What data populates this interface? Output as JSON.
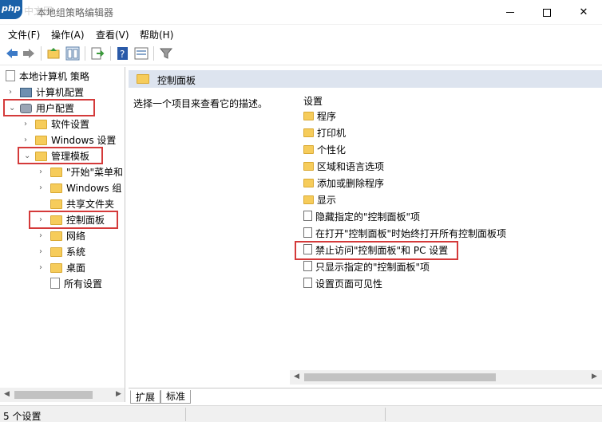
{
  "window": {
    "title": "本地组策略编辑器",
    "app_icon_text": "php",
    "watermark": "中文网",
    "minimize": "minimize",
    "maximize": "maximize",
    "close": "close"
  },
  "menu": [
    "文件(F)",
    "操作(A)",
    "查看(V)",
    "帮助(H)"
  ],
  "toolbar": {
    "icons": [
      "back-icon",
      "forward-icon",
      "up-folder-icon",
      "show-hide-tree-icon",
      "export-list-icon",
      "help-icon",
      "properties-icon",
      "filter-icon"
    ]
  },
  "tree": {
    "root": "本地计算机 策略",
    "computer_config": "计算机配置",
    "user_config": "用户配置",
    "software_settings": "软件设置",
    "windows_settings": "Windows 设置",
    "admin_templates": "管理模板",
    "start_menu": "\"开始\"菜单和",
    "windows_components": "Windows 组",
    "shared_folders": "共享文件夹",
    "control_panel": "控制面板",
    "network": "网络",
    "system": "系统",
    "desktop": "桌面",
    "all_settings": "所有设置"
  },
  "right": {
    "header": "控制面板",
    "description": "选择一个项目来查看它的描述。",
    "column_header": "设置",
    "items": [
      {
        "label": "程序",
        "type": "folder"
      },
      {
        "label": "打印机",
        "type": "folder"
      },
      {
        "label": "个性化",
        "type": "folder"
      },
      {
        "label": "区域和语言选项",
        "type": "folder"
      },
      {
        "label": "添加或删除程序",
        "type": "folder"
      },
      {
        "label": "显示",
        "type": "folder"
      },
      {
        "label": "隐藏指定的\"控制面板\"项",
        "type": "setting"
      },
      {
        "label": "在打开\"控制面板\"时始终打开所有控制面板项",
        "type": "setting"
      },
      {
        "label": "禁止访问\"控制面板\"和 PC 设置",
        "type": "setting"
      },
      {
        "label": "只显示指定的\"控制面板\"项",
        "type": "setting"
      },
      {
        "label": "设置页面可见性",
        "type": "setting"
      }
    ]
  },
  "tabs": [
    "扩展",
    "标准"
  ],
  "status": "5 个设置",
  "colors": {
    "highlight_box": "#d43a3a",
    "header_band": "#dde4ef",
    "folder": "#f6cc5b"
  }
}
